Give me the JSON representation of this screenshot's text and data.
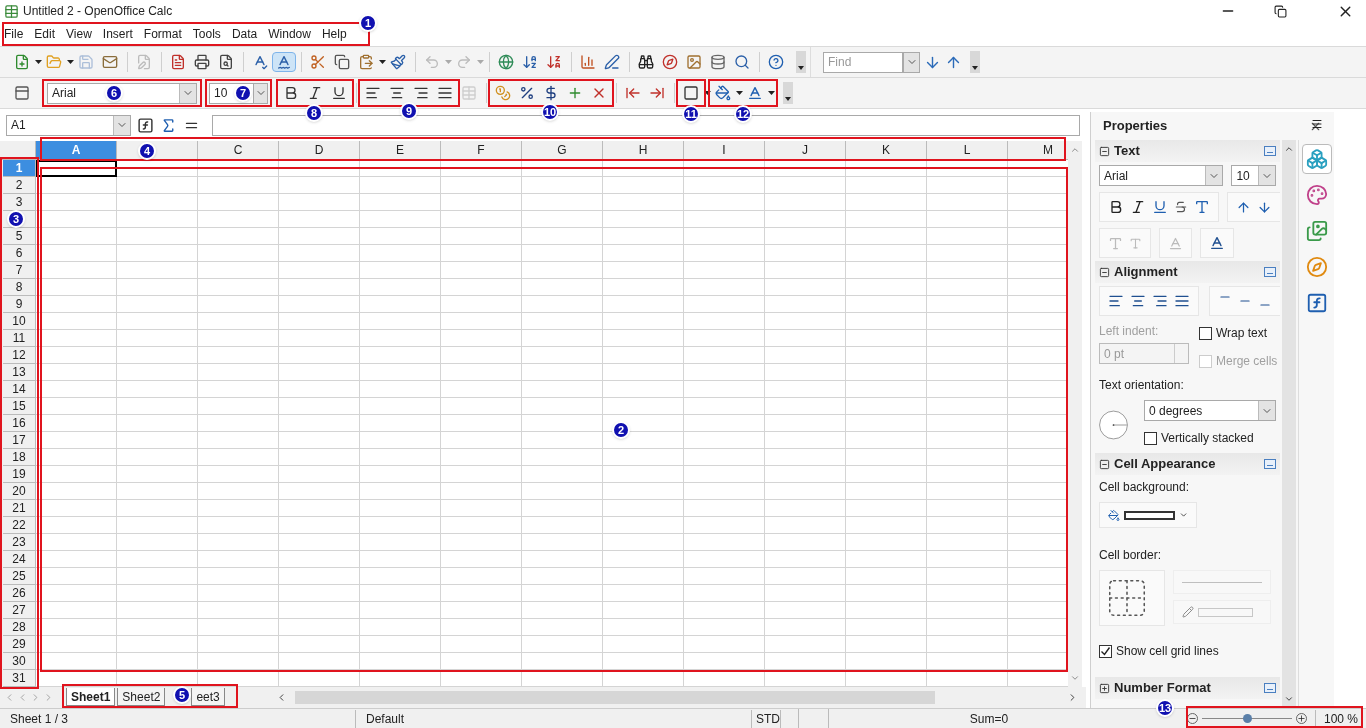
{
  "window": {
    "title": "Untitled 2 - OpenOffice Calc"
  },
  "menu": [
    "File",
    "Edit",
    "View",
    "Insert",
    "Format",
    "Tools",
    "Data",
    "Window",
    "Help"
  ],
  "toolbar_standard": [
    {
      "kind": "new",
      "disabled": false,
      "on": false
    },
    {
      "kind": "caret",
      "disabled": false,
      "on": false
    },
    {
      "kind": "open",
      "disabled": false,
      "on": false
    },
    {
      "kind": "caret",
      "disabled": false,
      "on": false
    },
    {
      "kind": "save",
      "disabled": true,
      "on": false
    },
    {
      "kind": "email",
      "disabled": false,
      "on": false
    },
    {
      "kind": "sep"
    },
    {
      "kind": "edit",
      "disabled": true,
      "on": false
    },
    {
      "kind": "sep"
    },
    {
      "kind": "pdf",
      "disabled": false,
      "on": false
    },
    {
      "kind": "print",
      "disabled": false,
      "on": false
    },
    {
      "kind": "preview",
      "disabled": false,
      "on": false
    },
    {
      "kind": "sep"
    },
    {
      "kind": "spell",
      "disabled": false,
      "on": false
    },
    {
      "kind": "autospell",
      "disabled": false,
      "on": true
    },
    {
      "kind": "sep"
    },
    {
      "kind": "cut",
      "disabled": false,
      "on": false
    },
    {
      "kind": "copy",
      "disabled": false,
      "on": false
    },
    {
      "kind": "paste",
      "disabled": false,
      "on": false
    },
    {
      "kind": "caret",
      "disabled": false,
      "on": false
    },
    {
      "kind": "clone",
      "disabled": false,
      "on": false
    },
    {
      "kind": "sep"
    },
    {
      "kind": "undo",
      "disabled": true,
      "on": false
    },
    {
      "kind": "caret",
      "disabled": true,
      "on": false
    },
    {
      "kind": "redo",
      "disabled": true,
      "on": false
    },
    {
      "kind": "caret",
      "disabled": true,
      "on": false
    },
    {
      "kind": "sep"
    },
    {
      "kind": "hyperlink",
      "disabled": false,
      "on": false
    },
    {
      "kind": "sortasc",
      "disabled": false,
      "on": false
    },
    {
      "kind": "sortdesc",
      "disabled": false,
      "on": false
    },
    {
      "kind": "sep"
    },
    {
      "kind": "chart",
      "disabled": false,
      "on": false
    },
    {
      "kind": "draw",
      "disabled": false,
      "on": false
    },
    {
      "kind": "sep"
    },
    {
      "kind": "findreplace",
      "disabled": false,
      "on": false
    },
    {
      "kind": "navigator",
      "disabled": false,
      "on": false
    },
    {
      "kind": "gallery",
      "disabled": false,
      "on": false
    },
    {
      "kind": "datasource",
      "disabled": false,
      "on": false
    },
    {
      "kind": "zoom",
      "disabled": false,
      "on": false
    },
    {
      "kind": "sep"
    },
    {
      "kind": "help",
      "disabled": false,
      "on": false
    },
    {
      "kind": "overflow",
      "disabled": false,
      "on": false
    }
  ],
  "find_toolbar": {
    "placeholder": "Find"
  },
  "formatting": {
    "font": "Arial",
    "size": "10"
  },
  "toolbar_formatting": [
    {
      "kind": "bold",
      "disabled": false,
      "on": false
    },
    {
      "kind": "italic",
      "disabled": false,
      "on": false
    },
    {
      "kind": "underline",
      "disabled": false,
      "on": false
    },
    {
      "kind": "sep"
    },
    {
      "kind": "alignleft",
      "disabled": false,
      "on": false
    },
    {
      "kind": "aligncenter",
      "disabled": false,
      "on": false
    },
    {
      "kind": "alignright",
      "disabled": false,
      "on": false
    },
    {
      "kind": "justify",
      "disabled": false,
      "on": false
    },
    {
      "kind": "merge",
      "disabled": true,
      "on": false
    },
    {
      "kind": "sep"
    },
    {
      "kind": "currency",
      "disabled": false,
      "on": false
    },
    {
      "kind": "percent",
      "disabled": false,
      "on": false
    },
    {
      "kind": "standard",
      "disabled": false,
      "on": false
    },
    {
      "kind": "adddecimal",
      "disabled": false,
      "on": false
    },
    {
      "kind": "deldecimal",
      "disabled": false,
      "on": false
    },
    {
      "kind": "sep"
    },
    {
      "kind": "outdent",
      "disabled": false,
      "on": false
    },
    {
      "kind": "indent",
      "disabled": false,
      "on": false
    },
    {
      "kind": "sep"
    },
    {
      "kind": "borders",
      "disabled": false,
      "on": false
    },
    {
      "kind": "caret",
      "disabled": false,
      "on": false
    },
    {
      "kind": "bgcolor",
      "disabled": false,
      "on": false
    },
    {
      "kind": "caret",
      "disabled": false,
      "on": false
    },
    {
      "kind": "fontcolor",
      "disabled": false,
      "on": false
    },
    {
      "kind": "caret",
      "disabled": false,
      "on": false
    },
    {
      "kind": "overflow",
      "disabled": false,
      "on": false
    }
  ],
  "formula_bar": {
    "name_box": "A1"
  },
  "grid": {
    "columns": [
      {
        "label": "A",
        "selected": true
      },
      {
        "selected": false
      },
      {
        "label": "C",
        "selected": false
      },
      {
        "label": "D",
        "selected": false
      },
      {
        "label": "E",
        "selected": false
      },
      {
        "label": "F",
        "selected": false
      },
      {
        "label": "G",
        "selected": false
      },
      {
        "label": "H",
        "selected": false
      },
      {
        "label": "I",
        "selected": false
      },
      {
        "label": "J",
        "selected": false
      },
      {
        "label": "K",
        "selected": false
      },
      {
        "label": "L",
        "selected": false
      },
      {
        "label": "M",
        "selected": false
      }
    ],
    "rows": [
      {
        "label": "1",
        "selected": true
      },
      {
        "label": "2",
        "selected": false
      },
      {
        "label": "3",
        "selected": false
      },
      {
        "selected": false
      },
      {
        "label": "5",
        "selected": false
      },
      {
        "label": "6",
        "selected": false
      },
      {
        "label": "7",
        "selected": false
      },
      {
        "label": "8",
        "selected": false
      },
      {
        "label": "9",
        "selected": false
      },
      {
        "label": "10",
        "selected": false
      },
      {
        "label": "11",
        "selected": false
      },
      {
        "label": "12",
        "selected": false
      },
      {
        "label": "13",
        "selected": false
      },
      {
        "label": "14",
        "selected": false
      },
      {
        "label": "15",
        "selected": false
      },
      {
        "label": "16",
        "selected": false
      },
      {
        "label": "17",
        "selected": false
      },
      {
        "label": "18",
        "selected": false
      },
      {
        "label": "19",
        "selected": false
      },
      {
        "label": "20",
        "selected": false
      },
      {
        "label": "21",
        "selected": false
      },
      {
        "label": "22",
        "selected": false
      },
      {
        "label": "23",
        "selected": false
      },
      {
        "label": "24",
        "selected": false
      },
      {
        "label": "25",
        "selected": false
      },
      {
        "label": "26",
        "selected": false
      },
      {
        "label": "27",
        "selected": false
      },
      {
        "label": "28",
        "selected": false
      },
      {
        "label": "29",
        "selected": false
      },
      {
        "label": "30",
        "selected": false
      },
      {
        "label": "31",
        "selected": false
      }
    ]
  },
  "sheet_tabs": [
    {
      "label": "Sheet1",
      "selected": true
    },
    {
      "label": "Sheet2",
      "selected": false
    },
    {
      "label": "eet3",
      "selected": false
    }
  ],
  "sidebar": {
    "title": "Properties",
    "text": {
      "title": "Text",
      "expanded": true,
      "font": "Arial",
      "size": "10"
    },
    "alignment": {
      "title": "Alignment",
      "expanded": true,
      "left_indent_label": "Left indent:",
      "left_indent": "0 pt",
      "wrap_text": {
        "label": "Wrap text",
        "checked": false,
        "disabled": false
      },
      "merge_cells": {
        "label": "Merge cells",
        "checked": false,
        "disabled": true
      },
      "orientation_label": "Text orientation:",
      "orientation": "0 degrees",
      "vertically_stacked": {
        "label": "Vertically stacked",
        "checked": false,
        "disabled": false
      }
    },
    "cell_appearance": {
      "title": "Cell Appearance",
      "expanded": true,
      "background_label": "Cell background:",
      "border_label": "Cell border:",
      "grid_lines": {
        "label": "Show cell grid lines",
        "checked": true,
        "disabled": false
      }
    },
    "number_format": {
      "title": "Number Format",
      "expanded": false
    },
    "deck": [
      {
        "kind": "properties",
        "selected": true
      },
      {
        "kind": "styles",
        "selected": false
      },
      {
        "kind": "gallery",
        "selected": false
      },
      {
        "kind": "navigator",
        "selected": false
      },
      {
        "kind": "functions",
        "selected": false
      }
    ]
  },
  "status_bar": {
    "sheet": "Sheet 1 / 3",
    "style": "Default",
    "mode": "STD",
    "sum": "Sum=0",
    "zoom": {
      "level": 0.5,
      "reading": "100 %"
    }
  },
  "callouts": [
    "1",
    "2",
    "3",
    "4",
    "5",
    "6",
    "7",
    "8",
    "9",
    "10",
    "11",
    "12",
    "13"
  ]
}
